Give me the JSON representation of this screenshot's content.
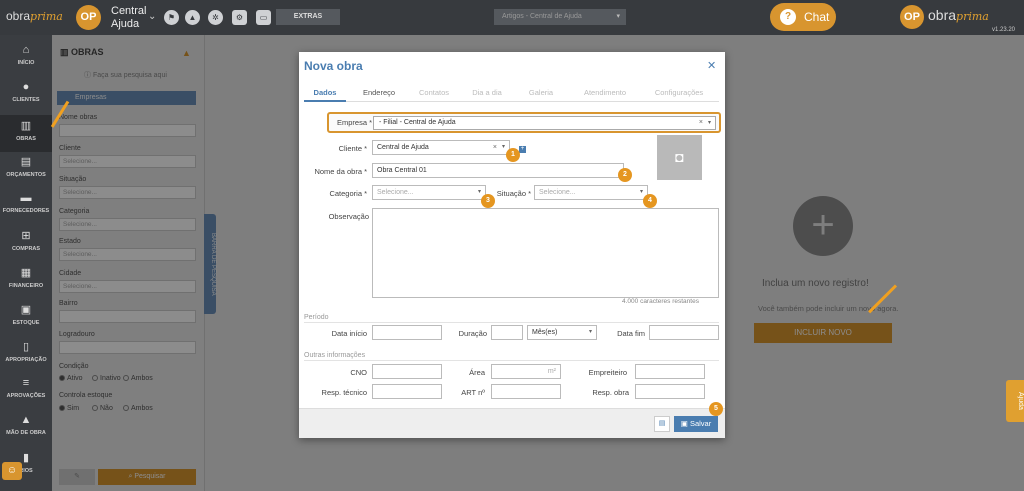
{
  "topbar": {
    "logo_a": "obra",
    "logo_b": "prima",
    "logo_icon": "OP",
    "company": "Central Ajuda",
    "icons": [
      "flag-icon",
      "graduation-cap-icon",
      "gear-icon",
      "settings-icon",
      "monitor-icon"
    ],
    "extras_label": "EXTRAS",
    "article_select": "Artigos - Central de Ajuda",
    "chat_label": "Chat",
    "brand_a": "obra",
    "brand_b": "prima",
    "version": "v1.23.20"
  },
  "sidebar": {
    "items": [
      {
        "label": "INÍCIO",
        "icon": "home-icon",
        "glyph": "⌂"
      },
      {
        "label": "CLIENTES",
        "icon": "user-icon",
        "glyph": "●"
      },
      {
        "label": "OBRAS",
        "icon": "building-icon",
        "glyph": "▥"
      },
      {
        "label": "ORÇAMENTOS",
        "icon": "calculator-icon",
        "glyph": "▤"
      },
      {
        "label": "FORNECEDORES",
        "icon": "truck-icon",
        "glyph": "▬"
      },
      {
        "label": "COMPRAS",
        "icon": "cart-icon",
        "glyph": "⊞"
      },
      {
        "label": "FINANCEIRO",
        "icon": "calculator-icon",
        "glyph": "▦"
      },
      {
        "label": "ESTOQUE",
        "icon": "boxes-icon",
        "glyph": "▣"
      },
      {
        "label": "APROPRIAÇÃO",
        "icon": "document-icon",
        "glyph": "▯"
      },
      {
        "label": "APROVAÇÕES",
        "icon": "list-check-icon",
        "glyph": "≡"
      },
      {
        "label": "MÃO DE OBRA",
        "icon": "workers-icon",
        "glyph": "▲"
      },
      {
        "label": "RIOS",
        "icon": "chart-icon",
        "glyph": "▮"
      }
    ],
    "active_index": 2
  },
  "filters": {
    "title": "OBRAS",
    "hint": "Faça sua pesquisa aqui",
    "tab": "Empresas",
    "fields": [
      {
        "label": "Nome obras",
        "placeholder": ""
      },
      {
        "label": "Cliente",
        "placeholder": "Selecione..."
      },
      {
        "label": "Situação",
        "placeholder": "Selecione..."
      },
      {
        "label": "Categoria",
        "placeholder": "Selecione..."
      },
      {
        "label": "Estado",
        "placeholder": "Selecione..."
      },
      {
        "label": "Cidade",
        "placeholder": "Selecione..."
      },
      {
        "label": "Bairro",
        "placeholder": ""
      },
      {
        "label": "Logradouro",
        "placeholder": ""
      }
    ],
    "condicao_label": "Condição",
    "condicao_options": [
      "Ativo",
      "Inativo",
      "Ambos"
    ],
    "estoque_label": "Controla estoque",
    "estoque_options": [
      "Sim",
      "Não",
      "Ambos"
    ],
    "search_label": "Pesquisar",
    "side_handle": "BARRA DE PESQUISA"
  },
  "empty_state": {
    "title": "Inclua um novo registro!",
    "subtitle": "Você também pode incluir um novo agora.",
    "button": "INCLUIR NOVO"
  },
  "help_tab": "Ajuda",
  "modal": {
    "title": "Nova obra",
    "tabs": [
      "Dados",
      "Endereço",
      "Contatos",
      "Dia a dia",
      "Galeria",
      "Atendimento",
      "Configurações"
    ],
    "active_tab": 0,
    "empresa_label": "Empresa *",
    "empresa_value": "- Filial - Central de Ajuda",
    "cliente_label": "Cliente *",
    "cliente_value": "Central de Ajuda",
    "nome_label": "Nome da obra *",
    "nome_value": "Obra Central 01",
    "categoria_label": "Categoria *",
    "categoria_placeholder": "Selecione...",
    "situacao_label": "Situação *",
    "situacao_placeholder": "Selecione...",
    "observacao_label": "Observação",
    "counter": "4.000 caracteres restantes",
    "periodo_section": "Período",
    "data_inicio_label": "Data início",
    "duracao_label": "Duração",
    "duracao_unit": "Mês(es)",
    "data_fim_label": "Data fim",
    "outras_section": "Outras informações",
    "cno_label": "CNO",
    "area_label": "Área",
    "area_unit": "m²",
    "empreiteiro_label": "Empreiteiro",
    "resp_tecnico_label": "Resp. técnico",
    "art_label": "ART nº",
    "resp_obra_label": "Resp. obra",
    "save_label": "Salvar",
    "badges": [
      "1",
      "2",
      "3",
      "4",
      "5"
    ]
  },
  "colors": {
    "accent": "#4a7db0",
    "orange": "#d8952f",
    "topbar": "#373a3e"
  }
}
